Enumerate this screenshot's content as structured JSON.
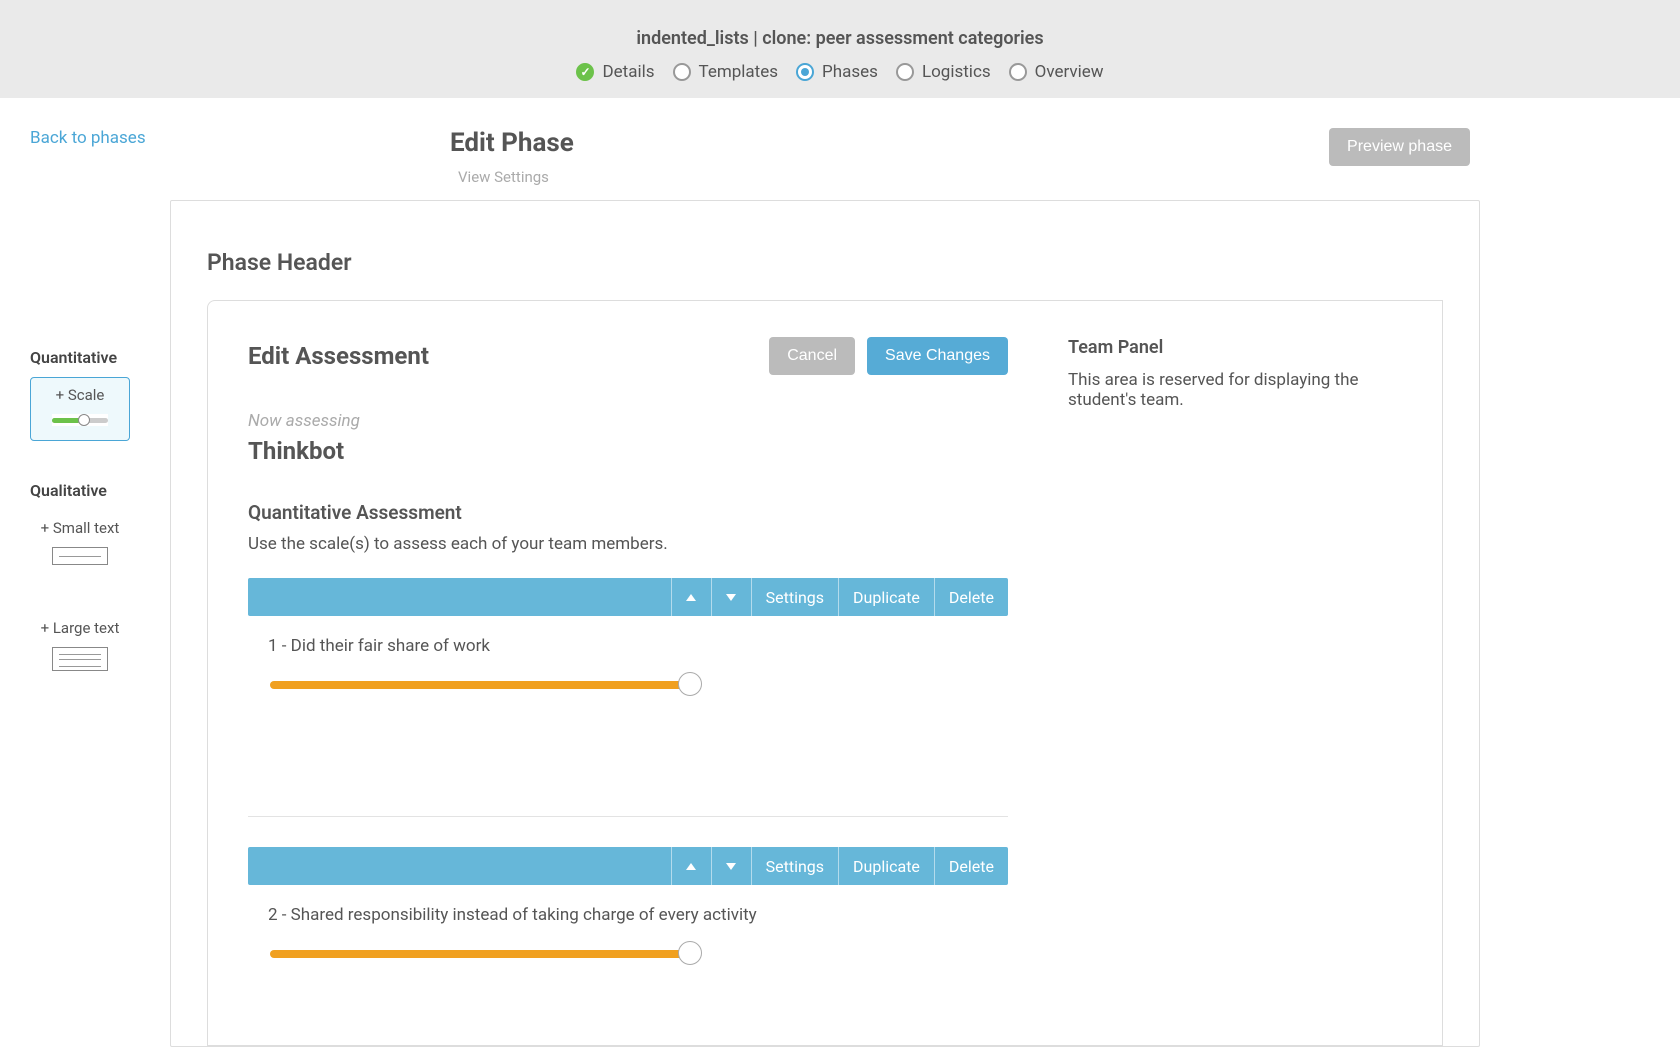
{
  "header": {
    "breadcrumb": "indented_lists | clone: peer assessment categories",
    "steps": [
      {
        "label": "Details",
        "state": "complete"
      },
      {
        "label": "Templates",
        "state": "pending"
      },
      {
        "label": "Phases",
        "state": "active"
      },
      {
        "label": "Logistics",
        "state": "pending"
      },
      {
        "label": "Overview",
        "state": "pending"
      }
    ]
  },
  "nav": {
    "back_link": "Back to phases"
  },
  "page": {
    "title": "Edit Phase",
    "view_settings": "View Settings",
    "preview_button": "Preview phase"
  },
  "palette": {
    "quantitative_heading": "Quantitative",
    "scale_label": "+ Scale",
    "qualitative_heading": "Qualitative",
    "small_text_label": "+ Small text",
    "large_text_label": "+ Large text"
  },
  "phase": {
    "header_title": "Phase Header",
    "edit_title": "Edit Assessment",
    "cancel": "Cancel",
    "save": "Save Changes",
    "now_assessing_label": "Now assessing",
    "assessee_name": "Thinkbot",
    "quant_heading": "Quantitative Assessment",
    "quant_instructions": "Use the scale(s) to assess each of your team members.",
    "toolbar": {
      "settings": "Settings",
      "duplicate": "Duplicate",
      "delete": "Delete"
    },
    "items": [
      {
        "label": "1 - Did their fair share of work"
      },
      {
        "label": "2 - Shared responsibility instead of taking charge of every activity"
      }
    ]
  },
  "side_panel": {
    "title": "Team Panel",
    "body": "This area is reserved for displaying the student's team."
  }
}
